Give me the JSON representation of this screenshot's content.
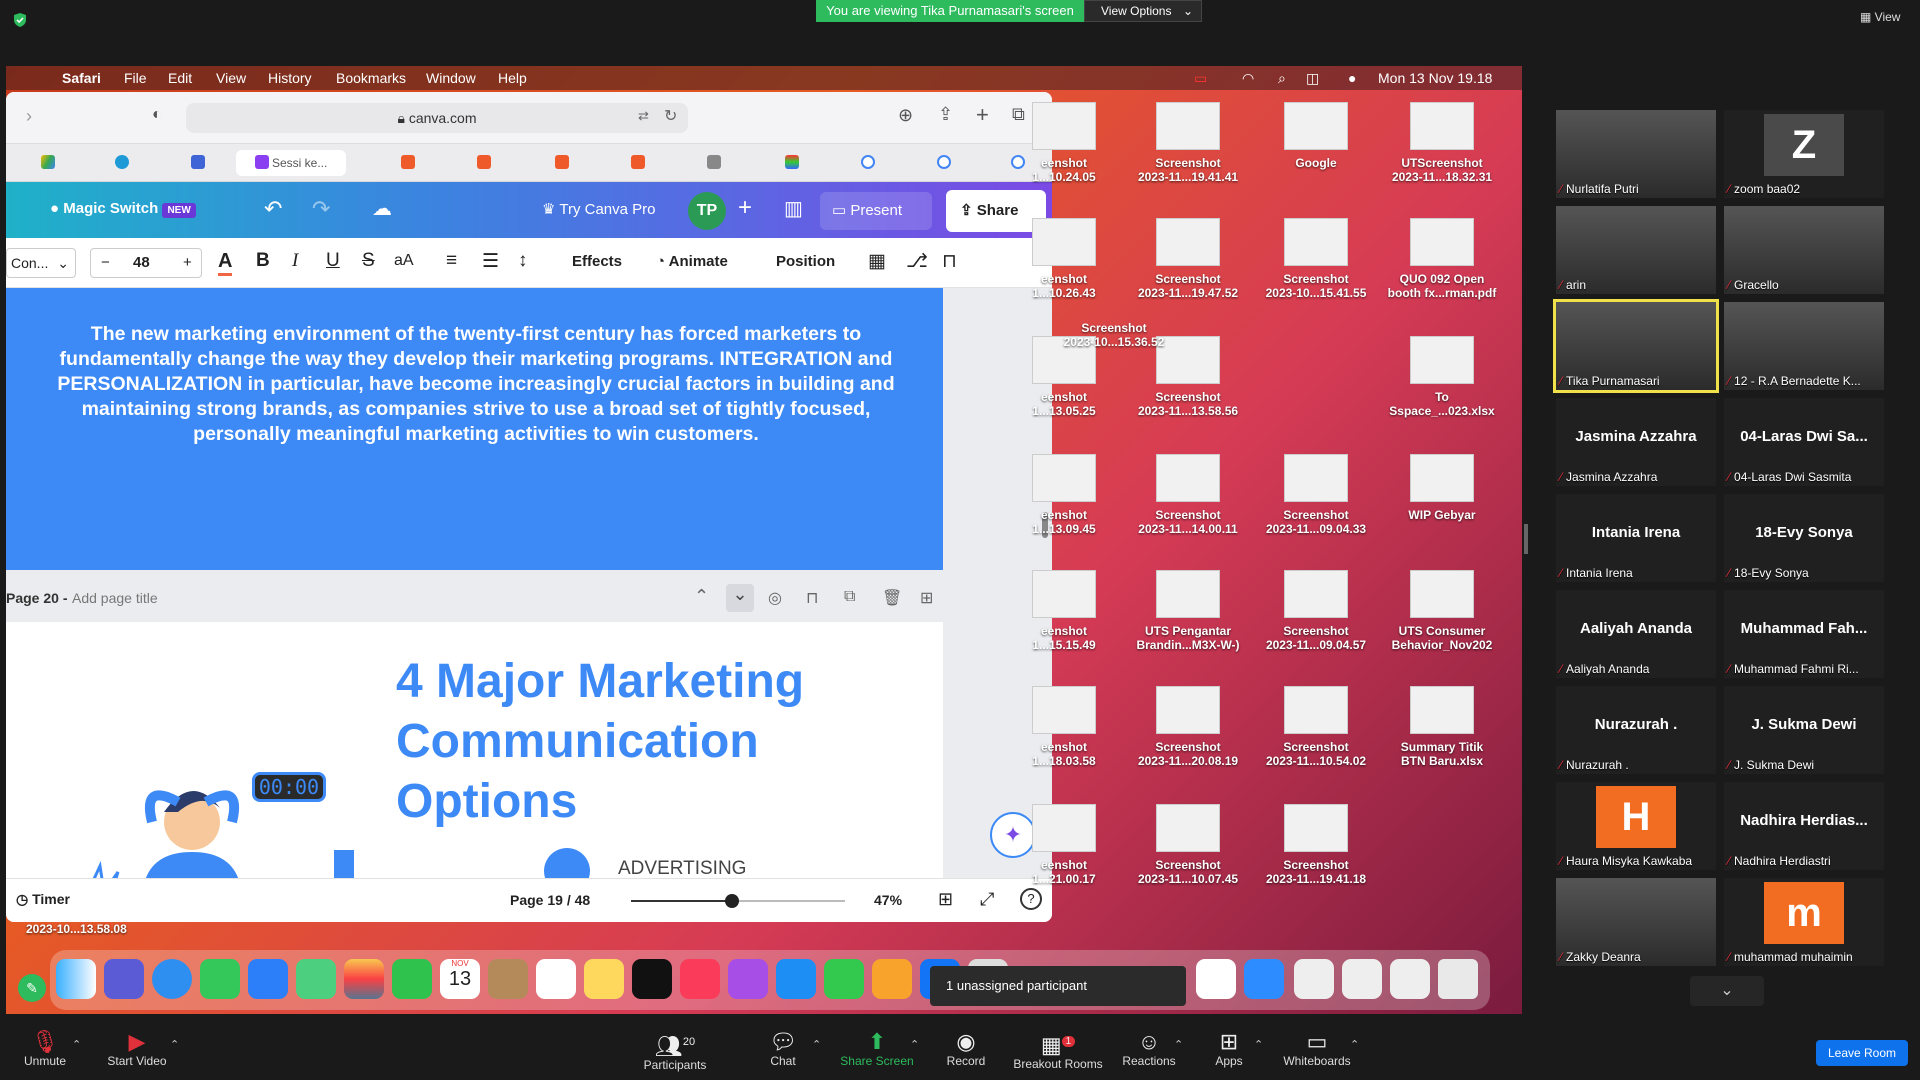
{
  "zoom": {
    "banner": "You are viewing Tika Purnamasari's screen",
    "view_options": "View Options",
    "view_btn": "View",
    "unassigned": "1 unassigned participant",
    "participants_count": "20",
    "breakout_badge": "1",
    "leave": "Leave Room",
    "controls": [
      "Unmute",
      "Start Video",
      "Participants",
      "Chat",
      "Share Screen",
      "Record",
      "Breakout Rooms",
      "Reactions",
      "Apps",
      "Whiteboards"
    ],
    "gallery": [
      {
        "name": "Nurlatifa Putri",
        "big": "",
        "kind": "video"
      },
      {
        "name": "zoom baa02",
        "big": "Z",
        "kind": "avatar"
      },
      {
        "name": "arin",
        "big": "",
        "kind": "video"
      },
      {
        "name": "Gracello",
        "big": "",
        "kind": "video"
      },
      {
        "name": "Tika Purnamasari",
        "big": "",
        "kind": "video"
      },
      {
        "name": "12 - R.A Bernadette K...",
        "big": "",
        "kind": "video"
      },
      {
        "name": "Jasmina Azzahra",
        "big": "Jasmina Azzahra",
        "kind": "text"
      },
      {
        "name": "04-Laras Dwi Sasmita",
        "big": "04-Laras Dwi Sa...",
        "kind": "text"
      },
      {
        "name": "Intania Irena",
        "big": "Intania Irena",
        "kind": "text"
      },
      {
        "name": "18-Evy Sonya",
        "big": "18-Evy Sonya",
        "kind": "text"
      },
      {
        "name": "Aaliyah Ananda",
        "big": "Aaliyah Ananda",
        "kind": "text"
      },
      {
        "name": "Muhammad Fahmi Ri...",
        "big": "Muhammad  Fah...",
        "kind": "text"
      },
      {
        "name": "Nurazurah .",
        "big": "Nurazurah .",
        "kind": "text"
      },
      {
        "name": "J. Sukma Dewi",
        "big": "J. Sukma Dewi",
        "kind": "text"
      },
      {
        "name": "Haura Misyka Kawkaba",
        "big": "H",
        "kind": "avatar-h"
      },
      {
        "name": "Nadhira Herdiastri",
        "big": "Nadhira  Herdias...",
        "kind": "text"
      },
      {
        "name": "Zakky Deanra",
        "big": "",
        "kind": "video"
      },
      {
        "name": "muhammad muhaimin",
        "big": "m",
        "kind": "avatar-m"
      }
    ]
  },
  "mac": {
    "menu": [
      "Safari",
      "File",
      "Edit",
      "View",
      "History",
      "Bookmarks",
      "Window",
      "Help"
    ],
    "clock": "Mon 13 Nov  19.18"
  },
  "safari": {
    "url": "canva.com",
    "tabs": [
      "",
      "",
      "",
      "Sessi ke...",
      "",
      "",
      "",
      "",
      "",
      "",
      "",
      ""
    ]
  },
  "canva": {
    "magic_switch": "Magic Switch",
    "new_badge": "NEW",
    "try_pro": "Try Canva Pro",
    "avatar": "TP",
    "present": "Present",
    "share": "Share",
    "font": "Con...",
    "font_size": "48",
    "effects": "Effects",
    "animate": "Animate",
    "position": "Position",
    "slide19_text": "The new marketing environment of the twenty-first century has forced marketers to fundamentally change the way they develop their marketing programs. INTEGRATION and PERSONALIZATION in particular, have become increasingly crucial factors in building and maintaining strong brands, as companies strive to use a broad set of tightly focused, personally meaningful marketing activities to win customers.",
    "page20_label": "Page 20 -",
    "page20_placeholder": "Add page title",
    "slide20_title": "4 Major Marketing Communication Options",
    "timer_badge": "00:00",
    "advertising": "ADVERTISING",
    "timer": "Timer",
    "page_indicator": "Page 19 / 48",
    "zoom_level": "47%",
    "zoom_fraction": 0.47
  },
  "desktop": {
    "icons": [
      {
        "label": "eenshot\n1...10.24.05",
        "col": 0,
        "row": 0
      },
      {
        "label": "Screenshot\n2023-11...19.41.41",
        "col": 1,
        "row": 0
      },
      {
        "label": "Google",
        "col": 2,
        "row": 0
      },
      {
        "label": "UTScreenshot\n2023-11...18.32.31",
        "col": 3,
        "row": 0
      },
      {
        "label": "eenshot\n1...10.26.43",
        "col": 0,
        "row": 1
      },
      {
        "label": "Screenshot\n2023-11...19.47.52",
        "col": 1,
        "row": 1
      },
      {
        "label": "Screenshot\n2023-10...15.41.55",
        "col": 2,
        "row": 1
      },
      {
        "label": "QUO 092 Open\nbooth fx...rman.pdf",
        "col": 3,
        "row": 1
      },
      {
        "label": "eenshot\n1...13.05.25",
        "col": 0,
        "row": 2
      },
      {
        "label": "Screenshot\n2023-11...13.58.56",
        "col": 1,
        "row": 2
      },
      {
        "label": "To\nSspace_...023.xlsx",
        "col": 3,
        "row": 2
      },
      {
        "label": "eenshot\n1...13.09.45",
        "col": 0,
        "row": 3
      },
      {
        "label": "Screenshot\n2023-11...14.00.11",
        "col": 1,
        "row": 3
      },
      {
        "label": "Screenshot\n2023-11...09.04.33",
        "col": 2,
        "row": 3
      },
      {
        "label": "WIP Gebyar",
        "col": 3,
        "row": 3
      },
      {
        "label": "eenshot\n1...15.15.49",
        "col": 0,
        "row": 4
      },
      {
        "label": "UTS Pengantar\nBrandin...M3X-W-)",
        "col": 1,
        "row": 4
      },
      {
        "label": "Screenshot\n2023-11...09.04.57",
        "col": 2,
        "row": 4
      },
      {
        "label": "UTS Consumer\nBehavior_Nov202",
        "col": 3,
        "row": 4
      },
      {
        "label": "eenshot\n1...18.03.58",
        "col": 0,
        "row": 5
      },
      {
        "label": "Screenshot\n2023-11...20.08.19",
        "col": 1,
        "row": 5
      },
      {
        "label": "Screenshot\n2023-11...10.54.02",
        "col": 2,
        "row": 5
      },
      {
        "label": "Summary Titik\nBTN Baru.xlsx",
        "col": 3,
        "row": 5
      },
      {
        "label": "eenshot\n1...21.00.17",
        "col": 0,
        "row": 6
      },
      {
        "label": "Screenshot\n2023-11...10.07.45",
        "col": 1,
        "row": 6
      },
      {
        "label": "Screenshot\n2023-11...19.41.18",
        "col": 2,
        "row": 6
      }
    ],
    "extra": "Screenshot\n2023-10...15.36.52",
    "below_safari": "2023-10...13.58.08",
    "dock_date": "13",
    "dock_month": "NOV"
  }
}
